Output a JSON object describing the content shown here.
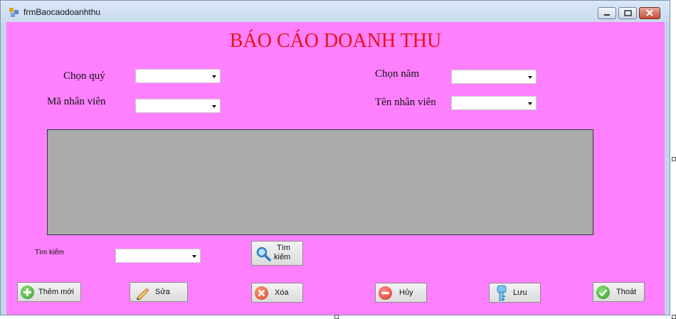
{
  "window": {
    "title": "frmBaocaodoanhthu"
  },
  "heading": "BÁO CÁO DOANH THU",
  "filters": {
    "quarter_label": "Chọn quý",
    "year_label": "Chọn năm",
    "employee_id_label": "Mã nhân viên",
    "employee_name_label": "Tên nhân viên"
  },
  "search": {
    "label": "Tìm kiếm",
    "button_line1": "Tìm",
    "button_line2": "kiếm"
  },
  "actions": {
    "add": "Thêm mới",
    "edit": "Sửa",
    "delete": "Xóa",
    "cancel": "Hủy",
    "save": "Lưu",
    "exit": "Thoát"
  },
  "colors": {
    "background": "#ff80ff",
    "heading": "#e8121c",
    "grid": "#ababab"
  }
}
